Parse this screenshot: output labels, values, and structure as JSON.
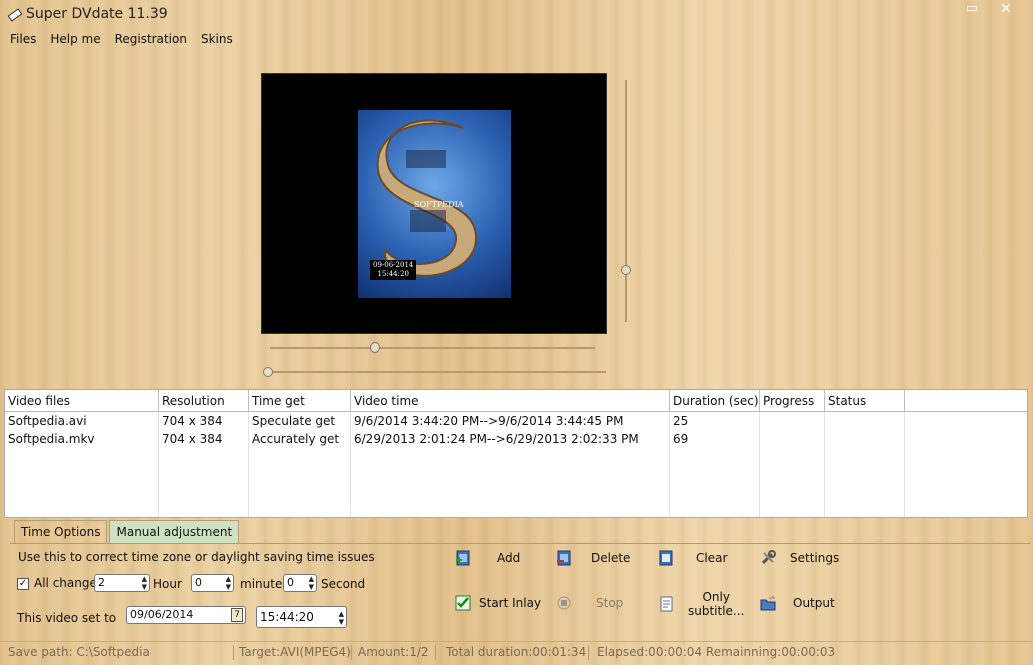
{
  "window": {
    "title": "Super DVdate  11.39",
    "minimize_glyph": "▭",
    "close_glyph": "✕"
  },
  "menu": [
    "Files",
    "Help me",
    "Registration",
    "Skins"
  ],
  "video": {
    "overlay_date": "09-06-2014",
    "overlay_time": "15:44:20",
    "watermark": "SOFTPEDIA"
  },
  "table": {
    "headers": [
      "Video files",
      "Resolution",
      "Time get",
      "Video time",
      "Duration (sec)",
      "Progress",
      "Status"
    ],
    "rows": [
      [
        "Softpedia.avi",
        "704 x 384",
        "Speculate  get",
        "9/6/2014 3:44:20 PM-->9/6/2014 3:44:45 PM",
        "25",
        "",
        ""
      ],
      [
        "Softpedia.mkv",
        "704 x 384",
        "Accurately get",
        "6/29/2013 2:01:24 PM-->6/29/2013 2:02:33 PM",
        "69",
        "",
        ""
      ]
    ]
  },
  "tabs": {
    "time_options": "Time Options",
    "manual_adjustment": "Manual adjustment"
  },
  "manual": {
    "description": "Use this to correct time zone or daylight saving time issues",
    "all_change_label": "All change",
    "all_change_checked": "✓",
    "hour_value": "2",
    "hour_label": "Hour",
    "minute_value": "0",
    "minute_label": "minute",
    "second_value": "0",
    "second_label": "Second",
    "set_to_label": "This video set to",
    "date_value": "09/06/2014",
    "calendar_glyph": "7",
    "time_value": "15:44:20"
  },
  "actions": {
    "add": "Add",
    "delete": "Delete",
    "clear": "Clear",
    "settings": "Settings",
    "start_inlay": "Start Inlay",
    "stop": "Stop",
    "only_subtitle_line1": "Only",
    "only_subtitle_line2": "subtitle...",
    "output": "Output"
  },
  "status": {
    "save_path": "Save path:  C:\\Softpedia",
    "target": "Target:AVI(MPEG4)",
    "amount": "Amount:1/2",
    "total_duration": "Total duration:00:01:34",
    "elapsed": "Elapsed:00:00:04 Remainning:00:00:03"
  },
  "colors": {
    "accent_tab": "#cfe3c3",
    "wood": "#e8c996",
    "video_bg": "#000000"
  }
}
